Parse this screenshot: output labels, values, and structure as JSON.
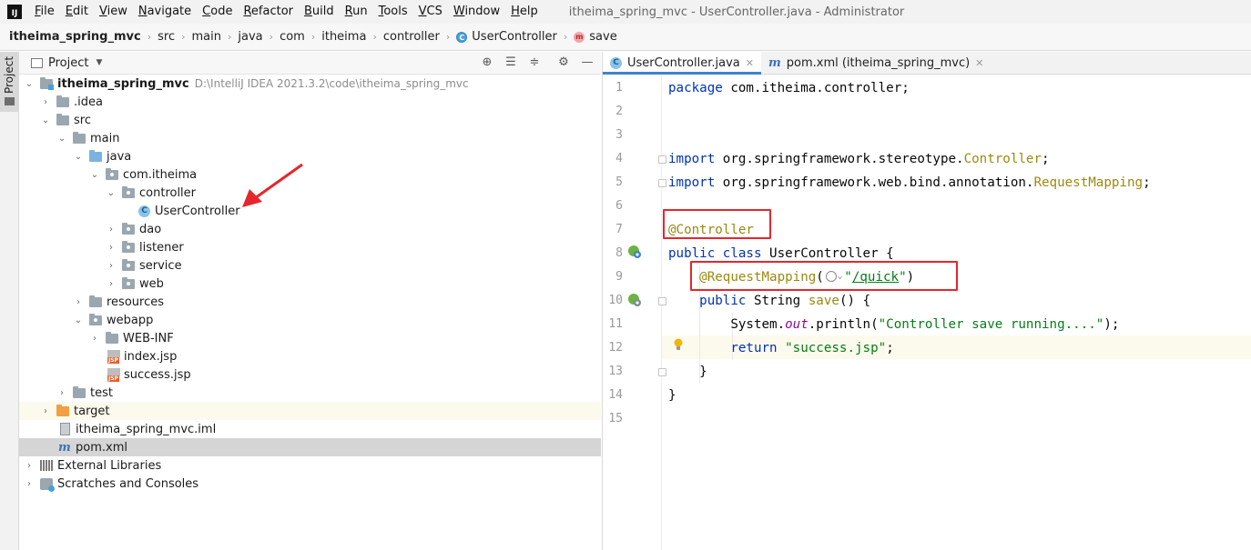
{
  "app_logo": "IJ",
  "menu": [
    "File",
    "Edit",
    "View",
    "Navigate",
    "Code",
    "Refactor",
    "Build",
    "Run",
    "Tools",
    "VCS",
    "Window",
    "Help"
  ],
  "window_title": "itheima_spring_mvc - UserController.java - Administrator",
  "breadcrumb": [
    "itheima_spring_mvc",
    "src",
    "main",
    "java",
    "com",
    "itheima",
    "controller",
    "UserController",
    "save"
  ],
  "sidebar_strip": {
    "label": "Project"
  },
  "project_panel": {
    "title": "Project"
  },
  "tree": [
    {
      "label": "itheima_spring_mvc",
      "path": "D:\\IntelliJ IDEA 2021.3.2\\code\\itheima_spring_mvc",
      "icon": "module-folder-icon",
      "expanded": true
    },
    {
      "label": ".idea",
      "icon": "folder-icon",
      "expanded": false
    },
    {
      "label": "src",
      "icon": "folder-icon",
      "expanded": true
    },
    {
      "label": "main",
      "icon": "folder-icon",
      "expanded": true
    },
    {
      "label": "java",
      "icon": "source-folder-icon",
      "expanded": true
    },
    {
      "label": "com.itheima",
      "icon": "package-icon",
      "expanded": true
    },
    {
      "label": "controller",
      "icon": "package-icon",
      "expanded": true
    },
    {
      "label": "UserController",
      "icon": "class-icon"
    },
    {
      "label": "dao",
      "icon": "package-icon",
      "expanded": false
    },
    {
      "label": "listener",
      "icon": "package-icon",
      "expanded": false
    },
    {
      "label": "service",
      "icon": "package-icon",
      "expanded": false
    },
    {
      "label": "web",
      "icon": "package-icon",
      "expanded": false
    },
    {
      "label": "resources",
      "icon": "resources-folder-icon",
      "expanded": false
    },
    {
      "label": "webapp",
      "icon": "web-folder-icon",
      "expanded": true
    },
    {
      "label": "WEB-INF",
      "icon": "folder-icon",
      "expanded": false
    },
    {
      "label": "index.jsp",
      "icon": "jsp-file-icon"
    },
    {
      "label": "success.jsp",
      "icon": "jsp-file-icon"
    },
    {
      "label": "test",
      "icon": "folder-icon",
      "expanded": false
    },
    {
      "label": "target",
      "icon": "excluded-folder-icon",
      "expanded": false
    },
    {
      "label": "itheima_spring_mvc.iml",
      "icon": "iml-file-icon"
    },
    {
      "label": "pom.xml",
      "icon": "maven-file-icon",
      "selected": true
    },
    {
      "label": "External Libraries",
      "icon": "library-icon",
      "expanded": false
    },
    {
      "label": "Scratches and Consoles",
      "icon": "scratches-icon",
      "expanded": false
    }
  ],
  "editor_tabs": [
    {
      "label": "UserController.java",
      "icon": "class-icon",
      "active": true
    },
    {
      "label": "pom.xml (itheima_spring_mvc)",
      "icon": "maven-file-icon",
      "active": false
    }
  ],
  "code": {
    "line_numbers": [
      "1",
      "2",
      "3",
      "4",
      "5",
      "6",
      "7",
      "8",
      "9",
      "10",
      "11",
      "12",
      "13",
      "14",
      "15"
    ],
    "lines": [
      [
        [
          "kw",
          "package"
        ],
        [
          "",
          "com.itheima.controller;"
        ]
      ],
      [],
      [],
      [
        [
          "kw",
          "import"
        ],
        [
          "",
          "org.springframework.stereotype."
        ],
        [
          "ann",
          "Controller"
        ],
        [
          "",
          ";"
        ]
      ],
      [
        [
          "kw",
          "import"
        ],
        [
          "",
          "org.springframework.web.bind.annotation."
        ],
        [
          "ann",
          "RequestMapping"
        ],
        [
          "",
          ";"
        ]
      ],
      [],
      [
        [
          "ann",
          "@Controller"
        ]
      ],
      [
        [
          "kw",
          "public class"
        ],
        [
          "",
          "UserController {"
        ]
      ],
      [
        [
          "ann",
          "@RequestMapping"
        ],
        [
          "",
          "("
        ],
        [
          "str",
          "\""
        ],
        [
          "url",
          "/quick"
        ],
        [
          "str",
          "\""
        ],
        [
          "",
          ")"
        ]
      ],
      [
        [
          "kw",
          "public"
        ],
        [
          "",
          "String "
        ],
        [
          "ann",
          "save"
        ],
        [
          "",
          "() {"
        ]
      ],
      [
        [
          "",
          "System."
        ],
        [
          "fld",
          "out"
        ],
        [
          "",
          ".println("
        ],
        [
          "str",
          "\"Controller save running....\""
        ],
        [
          "",
          ");"
        ]
      ],
      [
        [
          "kw",
          "return"
        ],
        [
          "str",
          "\"success.jsp\""
        ],
        [
          "",
          ";"
        ]
      ],
      [
        [
          "",
          "}"
        ]
      ],
      [
        [
          "",
          "}"
        ]
      ],
      []
    ]
  },
  "colors": {
    "annotation_box": "#e6262c",
    "keyword": "#0033b3",
    "annotation": "#9e880d",
    "string": "#067d17"
  }
}
